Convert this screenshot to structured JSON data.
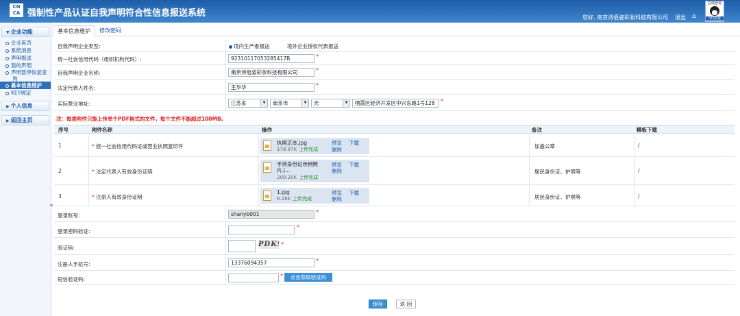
{
  "header": {
    "logo": "CN CA",
    "title": "强制性产品认证自我声明符合性信息报送系统",
    "user_greeting": "您好, 南京诗佰姿彩妆科技有限公司",
    "logout": "退出",
    "qq_top": "在线咨询",
    "qq_bottom": "QQ交谈"
  },
  "sidebar": {
    "section1": "企业功能",
    "items": [
      "企业首页",
      "系统消息",
      "声明报送",
      "我的声明",
      "声明暂停恢复查询",
      "基本信息维护",
      "KEY绑定"
    ],
    "active_index": 5,
    "section2": "个人信息",
    "section3": "返回主页"
  },
  "tabs": [
    "基本信息维护",
    "修改密码"
  ],
  "form": {
    "enterprise_type_label": "自我声明企业类型:",
    "enterprise_type_options": [
      "境内生产者报送",
      "境外企业授权代表报送"
    ],
    "enterprise_type_selected": 0,
    "credit_code_label": "统一社会信用代码（组织机构代码）:",
    "credit_code_value": "92310117053285417B",
    "name_label": "自我声明企业名称:",
    "name_value": "南京诗佰姿彩妆科技有限公司",
    "legal_rep_label": "法定代表人姓名:",
    "legal_rep_value": "王华华",
    "address_label": "实际营业地址:",
    "province": "江苏省",
    "city": "南京市",
    "district": "无",
    "address_detail": "栖霞区经济开发区中兴东路1号128",
    "required_mark": "*"
  },
  "notice": "注：每类附件只能上传单个PDF格式的文件，每个文件不能超过100MB。",
  "attachments": {
    "headers": [
      "序号",
      "附件名称",
      "操作",
      "备注",
      "模板下载"
    ],
    "rows": [
      {
        "no": "1",
        "name": "统一社会信用代码证或营业执照复印件",
        "file": "执照正本.jpg",
        "size": "178.97K",
        "status": "上传完成",
        "remark": "加盖公章",
        "template": "/"
      },
      {
        "no": "2",
        "name": "法定代表人有效身份证明",
        "file": "手持身份证示例照片.j...",
        "size": "200.20K",
        "status": "上传完成",
        "remark": "居民身份证、护照等",
        "template": "/"
      },
      {
        "no": "3",
        "name": "注册人有效身份证明",
        "file": "1.jpg",
        "size": "6.28K",
        "status": "上传完成",
        "remark": "居民身份证、护照等",
        "template": "/"
      }
    ],
    "preview": "预览",
    "download": "下载",
    "delete": "删除"
  },
  "account": {
    "login_label": "登录账号:",
    "login_value": "shanyb001",
    "password_label": "登录密码验证:",
    "captcha_label": "验证码:",
    "captcha_text": "PDK9",
    "phone_label": "注册人手机号:",
    "phone_value": "13376094357",
    "sms_label": "短信验证码:",
    "sms_button": "点击获取验证码"
  },
  "buttons": {
    "save": "保存",
    "back": "返 回"
  }
}
